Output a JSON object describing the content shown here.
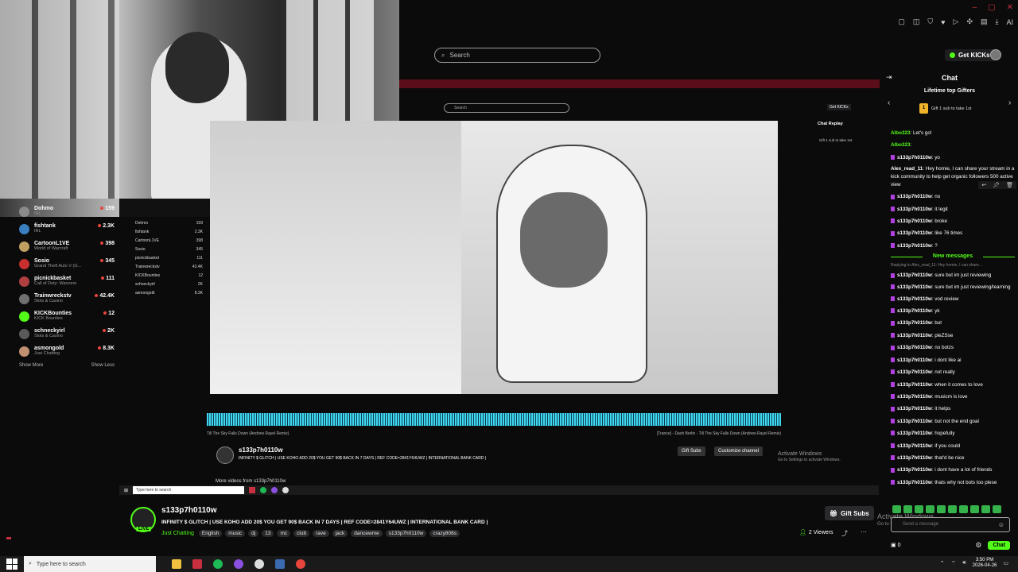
{
  "header": {
    "search_placeholder": "Search",
    "get_kicks_label": "Get KICKs",
    "window_controls": [
      "–",
      "▢",
      "✕"
    ],
    "extension_ai_label": "AI"
  },
  "sidebar": {
    "items": [
      {
        "name": "Dohmo",
        "category": "IRL",
        "viewers": "159",
        "avatar_color": "#8a8a8a"
      },
      {
        "name": "fishtank",
        "category": "IRL",
        "viewers": "2.3K",
        "avatar_color": "#3a7fc0"
      },
      {
        "name": "CartoonL1VE",
        "category": "World of Warcraft",
        "viewers": "398",
        "avatar_color": "#c0a060"
      },
      {
        "name": "Sosio",
        "category": "Grand Theft Auto V (G...",
        "viewers": "345",
        "avatar_color": "#c83030"
      },
      {
        "name": "picnickbasket",
        "category": "Call of Duty: Warzone",
        "viewers": "111",
        "avatar_color": "#b04040"
      },
      {
        "name": "Trainwreckstv",
        "category": "Slots & Casino",
        "viewers": "42.4K",
        "avatar_color": "#707070"
      },
      {
        "name": "KICKBounties",
        "category": "KICK Bounties",
        "viewers": "12",
        "avatar_color": "#53fc18"
      },
      {
        "name": "schneckyirl",
        "category": "Slots & Casino",
        "viewers": "2K",
        "avatar_color": "#5a5a5a"
      },
      {
        "name": "asmongold",
        "category": "Just Chatting",
        "viewers": "8.3K",
        "avatar_color": "#c09070"
      }
    ],
    "show_more": "Show More",
    "show_less": "Show Less"
  },
  "nested": {
    "search_placeholder": "Search",
    "get_kicks_label": "Get KICKs",
    "chat_replay": "Chat Replay",
    "gift_hint": "Gift 1 sub to take 1st",
    "sidebar_items": [
      {
        "name": "Dohmo",
        "viewers": "159"
      },
      {
        "name": "fishtank",
        "viewers": "2.3K"
      },
      {
        "name": "CartoonL1VE",
        "viewers": "398"
      },
      {
        "name": "Sosio",
        "viewers": "345"
      },
      {
        "name": "picnickbasket",
        "viewers": "111"
      },
      {
        "name": "Trainwreckstv",
        "viewers": "42.4K"
      },
      {
        "name": "KICKBounties",
        "viewers": "12"
      },
      {
        "name": "schneckyirl",
        "viewers": "2K"
      },
      {
        "name": "asmongold",
        "viewers": "8.3K"
      }
    ],
    "track_left": "Till The Sky Falls Down (Andrew Rayel Remix)",
    "track_right": "[Trance] - Dash Berlin - Till The Sky Falls Down (Andrew Rayel Remix)",
    "streamer": "s133p7h0110w",
    "title": "INFINITY $ GLITCH | USE KOHO ADD 20$ YOU GET 90$ BACK IN 7 DAYS | REF CODE=2841Y64UWZ | INTERNATIONAL BANK CARD |",
    "gift_subs": "Gift Subs",
    "customize": "Customize channel",
    "more_videos": "More videos from s133p7h0110w",
    "taskbar_search": "Type here to search",
    "activate_title": "Activate Windows",
    "activate_sub": "Go to Settings to activate Windows."
  },
  "stream": {
    "streamer": "s133p7h0110w",
    "live_label": "LIVE",
    "title": "INFINITY $ GLITCH | USE KOHO ADD 20$ YOU GET 90$ BACK IN 7 DAYS | REF CODE=2841Y64UWZ | INTERNATIONAL BANK CARD |",
    "category": "Just Chatting",
    "tags": [
      "English",
      "music",
      "dj",
      "13",
      "mc",
      "club",
      "rave",
      "jack",
      "dancewme",
      "s133p7h0110w",
      "crazy808s"
    ],
    "gift_subs_label": "Gift Subs",
    "viewers": "2 Viewers",
    "activate_title": "Activate Windows",
    "activate_sub": "Go to Settings to activate Windows."
  },
  "chat": {
    "title": "Chat",
    "gifters_title": "Lifetime top Gifters",
    "gift_hint": "Gift 1 sub to take 1st",
    "gift_coin": "1",
    "messages": [
      {
        "user": "Albo323",
        "text": "Let's go!",
        "color": "green"
      },
      {
        "user": "Albo323",
        "text": "",
        "color": "green"
      },
      {
        "user": "s133p7h0110w",
        "text": "yo",
        "color": "white",
        "badge": true
      },
      {
        "user": "Alex_read_11",
        "text": "Hey homie, I can share your stream in a kick community to help get organic followers 500 active view",
        "color": "white",
        "multi": true
      },
      {
        "user": "s133p7h0110w",
        "text": "no",
        "color": "white",
        "badge": true
      },
      {
        "user": "s133p7h0110w",
        "text": "it legit",
        "color": "white",
        "badge": true
      },
      {
        "user": "s133p7h0110w",
        "text": "broke",
        "color": "white",
        "badge": true
      },
      {
        "user": "s133p7h0110w",
        "text": "like 76 times",
        "color": "white",
        "badge": true
      },
      {
        "user": "s133p7h0110w",
        "text": "?",
        "color": "white",
        "badge": true
      }
    ],
    "new_messages_label": "New messages",
    "reply_to": "Replying to Alex_read_11: Hey homie, I can share...",
    "new_messages": [
      {
        "user": "s133p7h0110w",
        "text": "sure but im just reviewing",
        "badge": true
      },
      {
        "user": "s133p7h0110w",
        "text": "sure but im just reviewing/learning",
        "badge": true,
        "multi": true
      },
      {
        "user": "s133p7h0110w",
        "text": "vod review",
        "badge": true
      },
      {
        "user": "s133p7h0110w",
        "text": "yk",
        "badge": true
      },
      {
        "user": "s133p7h0110w",
        "text": "but",
        "badge": true
      },
      {
        "user": "s133p7h0110w",
        "text": "pleZSse",
        "badge": true
      },
      {
        "user": "s133p7h0110w",
        "text": "no botzs",
        "badge": true
      },
      {
        "user": "s133p7h0110w",
        "text": "i dont like ai",
        "badge": true
      },
      {
        "user": "s133p7h0110w",
        "text": "not really",
        "badge": true
      },
      {
        "user": "s133p7h0110w",
        "text": "when it comes to love",
        "badge": true
      },
      {
        "user": "s133p7h0110w",
        "text": "musicm is love",
        "badge": true
      },
      {
        "user": "s133p7h0110w",
        "text": "it helps",
        "badge": true
      },
      {
        "user": "s133p7h0110w",
        "text": "but not the end goal",
        "badge": true
      },
      {
        "user": "s133p7h0110w",
        "text": "hopefully",
        "badge": true
      },
      {
        "user": "s133p7h0110w",
        "text": "if you could",
        "badge": true
      },
      {
        "user": "s133p7h0110w",
        "text": "that'd be nice",
        "badge": true
      },
      {
        "user": "s133p7h0110w",
        "text": "i dont have a lot of friends",
        "badge": true
      },
      {
        "user": "s133p7h0110w",
        "text": "thats why not bots too plese",
        "badge": true
      }
    ],
    "input_placeholder": "Send a message",
    "points": "0",
    "chat_button": "Chat"
  },
  "taskbar": {
    "search_placeholder": "Type here to search",
    "time": "3:50 PM",
    "date": "2026-04-26"
  },
  "colors": {
    "kick_green": "#53fc18",
    "accent_red": "#c83040",
    "chat_bg": "#0b0b0c"
  }
}
